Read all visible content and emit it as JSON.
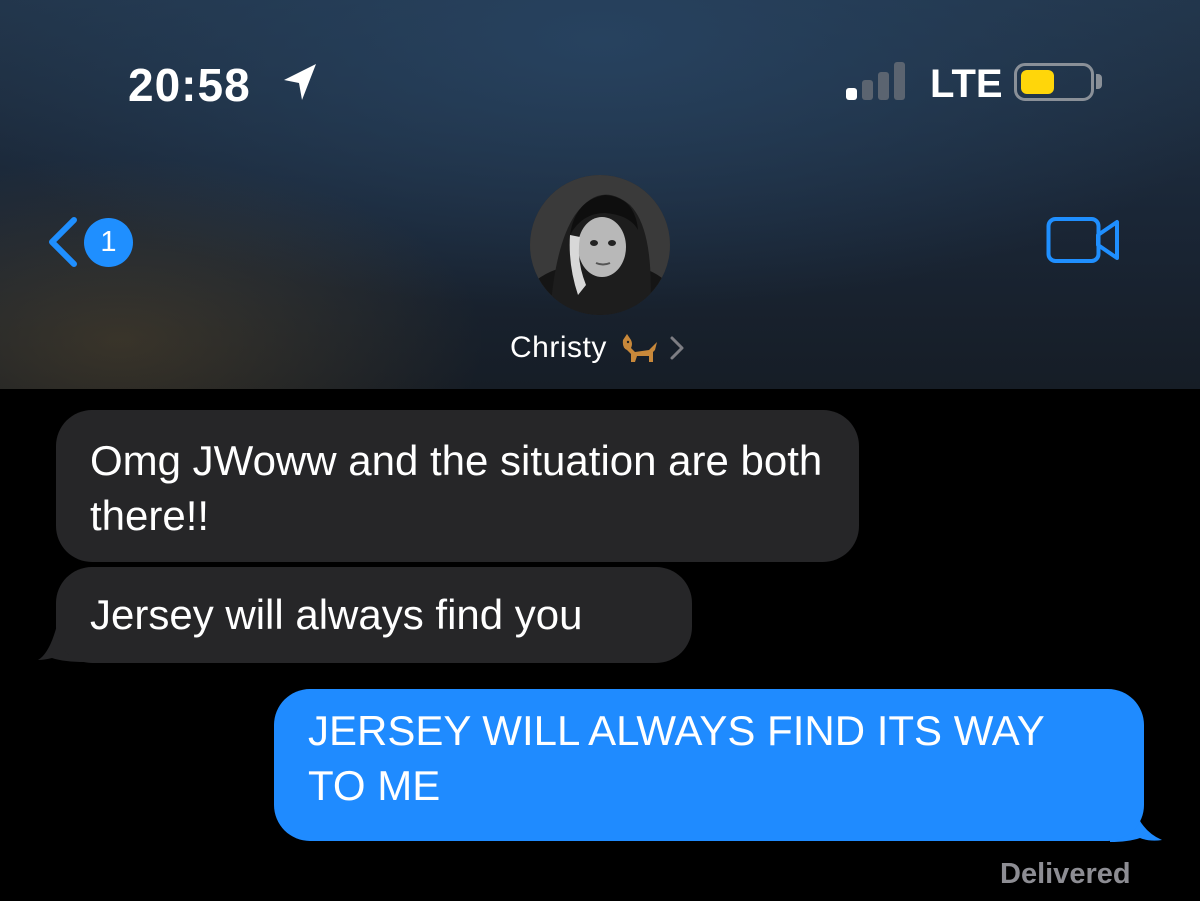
{
  "status_bar": {
    "time": "20:58",
    "network": "LTE",
    "location_icon": "location-arrow-icon",
    "battery_color": "#ffd60a"
  },
  "nav": {
    "back_badge_count": "1",
    "back_icon": "chevron-left-icon",
    "video_icon": "video-camera-icon",
    "accent_color": "#1f8fff"
  },
  "contact": {
    "name": "Christy",
    "emoji_icon": "dog-emoji-icon",
    "chevron_icon": "chevron-right-icon"
  },
  "messages": [
    {
      "direction": "incoming",
      "text": "Omg JWoww and the situation are both there!!"
    },
    {
      "direction": "incoming",
      "text": "Jersey will always find you"
    },
    {
      "direction": "outgoing",
      "text": "JERSEY WILL ALWAYS FIND ITS WAY TO ME"
    }
  ],
  "delivery_status": "Delivered",
  "colors": {
    "incoming_bubble": "#262628",
    "outgoing_bubble": "#1f8bff",
    "background": "#000000"
  }
}
